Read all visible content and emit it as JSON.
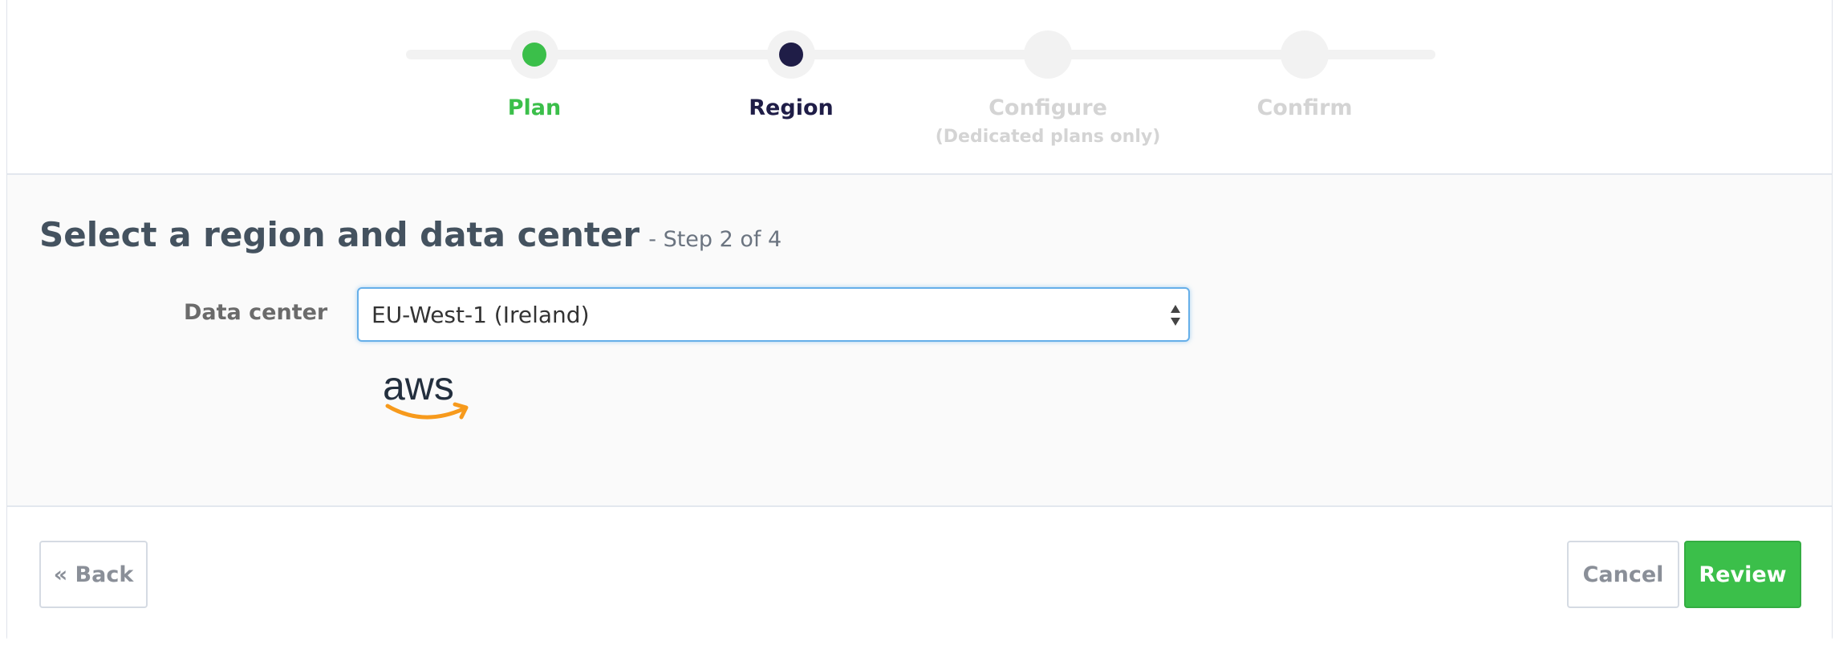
{
  "colors": {
    "done": "#3bbf4a",
    "active": "#1f1d47",
    "inactive": "#d4d4d4",
    "focus": "#66afe9"
  },
  "stepper": {
    "steps": [
      {
        "label": "Plan",
        "sublabel": "",
        "state": "done"
      },
      {
        "label": "Region",
        "sublabel": "",
        "state": "active"
      },
      {
        "label": "Configure",
        "sublabel": "(Dedicated plans only)",
        "state": "pending"
      },
      {
        "label": "Confirm",
        "sublabel": "",
        "state": "pending"
      }
    ]
  },
  "main": {
    "title": "Select a region and data center",
    "step_count": "- Step 2 of 4",
    "data_center": {
      "label": "Data center",
      "selected": "EU-West-1 (Ireland)"
    },
    "provider": {
      "logo_text": "aws",
      "icon": "aws-logo"
    }
  },
  "footer": {
    "back_label": "« Back",
    "cancel_label": "Cancel",
    "review_label": "Review"
  }
}
